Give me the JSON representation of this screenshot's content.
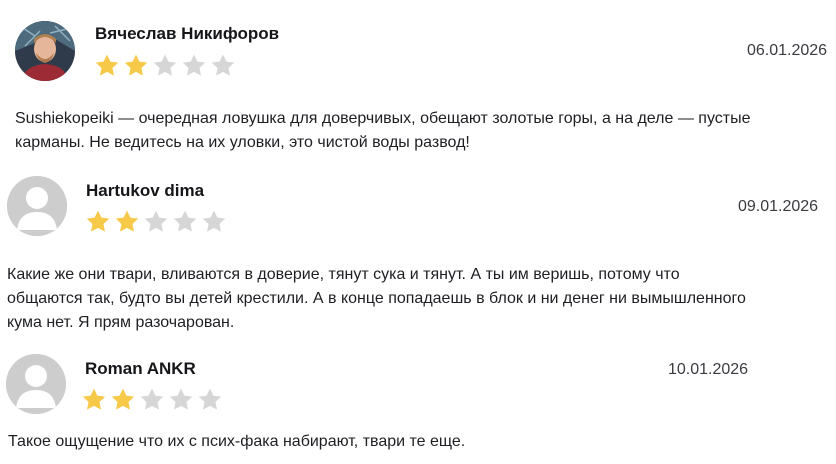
{
  "colors": {
    "star_filled": "#F7C948",
    "star_empty": "#D6D6D6",
    "avatar_placeholder": "#CDCDCD"
  },
  "reviews": [
    {
      "author": "Вячеслав Никифоров",
      "date": "06.01.2026",
      "rating": 2,
      "max_rating": 5,
      "avatar": "photo",
      "text": "Sushiekopeiki — очередная ловушка для доверчивых, обещают золотые горы, а на деле — пустые карманы. Не ведитесь на их уловки, это чистой воды развод!"
    },
    {
      "author": "Hartukov dima",
      "date": "09.01.2026",
      "rating": 2,
      "max_rating": 5,
      "avatar": "placeholder-user-icon",
      "text": "Какие же они твари, вливаются в доверие, тянут сука и тянут. А ты им веришь, потому что общаются так, будто вы детей крестили. А в конце попадаешь в блок и ни денег ни вымышленного кума нет. Я прям разочарован."
    },
    {
      "author": "Roman ANKR",
      "date": "10.01.2026",
      "rating": 2,
      "max_rating": 5,
      "avatar": "placeholder-user-icon",
      "text": "Такое ощущение что их с псих-фака набирают, твари те еще."
    }
  ]
}
